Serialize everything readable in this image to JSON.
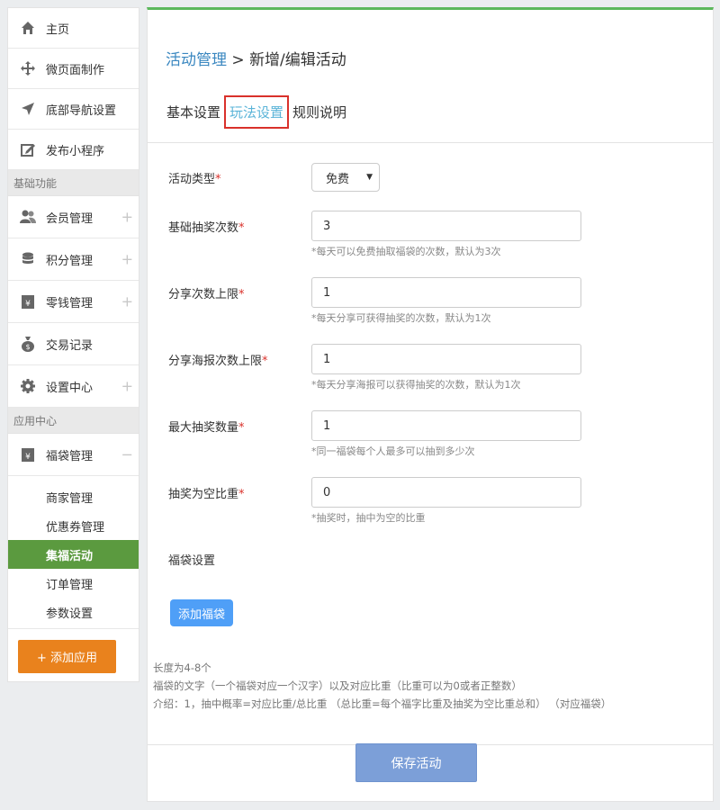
{
  "sidebar": {
    "top_items": [
      {
        "label": "主页",
        "icon": "home-icon"
      },
      {
        "label": "微页面制作",
        "icon": "move-icon"
      },
      {
        "label": "底部导航设置",
        "icon": "navigation-arrow-icon"
      },
      {
        "label": "发布小程序",
        "icon": "edit-icon"
      }
    ],
    "section_basic": "基础功能",
    "basic_items": [
      {
        "label": "会员管理",
        "icon": "users-icon",
        "expand": "+"
      },
      {
        "label": "积分管理",
        "icon": "database-icon",
        "expand": "+"
      },
      {
        "label": "零钱管理",
        "icon": "wallet-icon",
        "expand": "+"
      },
      {
        "label": "交易记录",
        "icon": "money-bag-icon"
      },
      {
        "label": "设置中心",
        "icon": "gear-icon",
        "expand": "+"
      }
    ],
    "section_apps": "应用中心",
    "app_group": {
      "label": "福袋管理",
      "icon": "lucky-bag-icon",
      "expand": "−"
    },
    "sub_items": [
      "商家管理",
      "优惠券管理",
      "集福活动",
      "订单管理",
      "参数设置"
    ],
    "active_sub": "集福活动",
    "add_app_label": "+ 添加应用"
  },
  "breadcrumb": {
    "link": "活动管理",
    "separator": " > ",
    "current": "新增/编辑活动"
  },
  "tabs": [
    "基本设置",
    "玩法设置",
    "规则说明"
  ],
  "active_tab": "玩法设置",
  "form": {
    "activity_type": {
      "label": "活动类型",
      "value": "免费"
    },
    "base_draws": {
      "label": "基础抽奖次数",
      "value": "3",
      "hint": "*每天可以免费抽取福袋的次数，默认为3次"
    },
    "share_limit": {
      "label": "分享次数上限",
      "value": "1",
      "hint": "*每天分享可获得抽奖的次数，默认为1次"
    },
    "poster_limit": {
      "label": "分享海报次数上限",
      "value": "1",
      "hint": "*每天分享海报可以获得抽奖的次数，默认为1次"
    },
    "max_draws": {
      "label": "最大抽奖数量",
      "value": "1",
      "hint": "*同一福袋每个人最多可以抽到多少次"
    },
    "empty_weight": {
      "label": "抽奖为空比重",
      "value": "0",
      "hint": "*抽奖时，抽中为空的比重"
    },
    "bag_settings_label": "福袋设置",
    "add_bag_label": "添加福袋",
    "required_mark": "*"
  },
  "notes": [
    "长度为4-8个",
    "福袋的文字（一个福袋对应一个汉字）以及对应比重（比重可以为0或者正整数）",
    "介绍：1，抽中概率=对应比重/总比重    （总比重=每个福字比重及抽奖为空比重总和）    （对应福袋）"
  ],
  "save_label": "保存活动",
  "colors": {
    "accent_green": "#5b9a3f",
    "top_border": "#5cb85c",
    "link_blue": "#3a87c0",
    "tab_active": "#5bb4d8",
    "highlight_red": "#d9312b",
    "add_app_orange": "#e9821d",
    "add_bag_blue": "#4f9ff7",
    "save_blue": "#7c9fd8"
  }
}
